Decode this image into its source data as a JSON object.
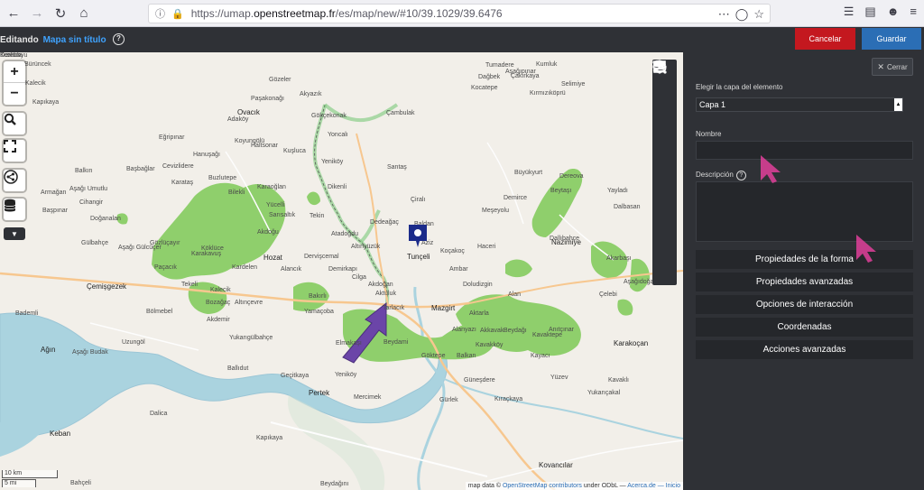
{
  "browser": {
    "url_prefix": "https://umap.",
    "url_domain": "openstreetmap.fr",
    "url_suffix": "/es/map/new/#10/39.1029/39.6476",
    "more_icon": "more-icon",
    "reader_icon": "pocket-icon",
    "star_icon": "bookmark-star-icon"
  },
  "header": {
    "editing_label": "Editando",
    "map_name": "Mapa sin título",
    "help_glyph": "?",
    "cancel_label": "Cancelar",
    "save_label": "Guardar"
  },
  "panel": {
    "close_label": "Cerrar",
    "layer_label": "Elegir la capa del elemento",
    "layer_value": "Capa 1",
    "name_label": "Nombre",
    "description_label": "Descripción",
    "help_glyph": "?",
    "sections": [
      "Propiedades de la forma",
      "Propiedades avanzadas",
      "Opciones de interacción",
      "Coordenadas",
      "Acciones avanzadas"
    ]
  },
  "map": {
    "marker_label": "Tunceli",
    "scale_km": "10 km",
    "scale_mi": "5 mi",
    "attribution_prefix": "map data © ",
    "attribution_link": "OpenStreetMap contributors",
    "attribution_suffix": " under ODbL — ",
    "attribution_about": "Acerca.de",
    "attribution_home": " — Inicio",
    "places": [
      {
        "name": "Bürüncek"
      },
      {
        "name": "Kalecik"
      },
      {
        "name": "Kapıkaya"
      },
      {
        "name": "Gözeler"
      },
      {
        "name": "Akyazık"
      },
      {
        "name": "Paşakonağı"
      },
      {
        "name": "Adaköy"
      },
      {
        "name": "Ovacık"
      },
      {
        "name": "Gökçekonak"
      },
      {
        "name": "Çambulak"
      },
      {
        "name": "Eğripınar"
      },
      {
        "name": "Yoncalı"
      },
      {
        "name": "Koyungölü"
      },
      {
        "name": "Kuşluca"
      },
      {
        "name": "Hanuşağı"
      },
      {
        "name": "Haltsonar"
      },
      {
        "name": "Yeniköy"
      },
      {
        "name": "Santaş"
      },
      {
        "name": "Balkın"
      },
      {
        "name": "Başbağlar"
      },
      {
        "name": "Cevizlidere"
      },
      {
        "name": "Buzlutepe"
      },
      {
        "name": "Karaoğlan"
      },
      {
        "name": "Dikenli"
      },
      {
        "name": "Aşağı Umutlu"
      },
      {
        "name": "Karataş"
      },
      {
        "name": "Bilekli"
      },
      {
        "name": "Armağan"
      },
      {
        "name": "Cihangir"
      },
      {
        "name": "Yücelli"
      },
      {
        "name": "Çiralı"
      },
      {
        "name": "Başpınar"
      },
      {
        "name": "Doğanalan"
      },
      {
        "name": "Sarısaltık"
      },
      {
        "name": "Tekin"
      },
      {
        "name": "Dedeağaç"
      },
      {
        "name": "Baldan"
      },
      {
        "name": "Gülbahçe"
      },
      {
        "name": "Aşağı Gülcüçer"
      },
      {
        "name": "Köklüce"
      },
      {
        "name": "Akdoğu"
      },
      {
        "name": "Atadoğdu"
      },
      {
        "name": "Koçakoç"
      },
      {
        "name": "Altınyüzük"
      },
      {
        "name": "Tunçeli"
      },
      {
        "name": "Aziz"
      },
      {
        "name": "Gözlüçayır"
      },
      {
        "name": "Karakavuş"
      },
      {
        "name": "Hozat"
      },
      {
        "name": "Dervişcemal"
      },
      {
        "name": "Demirkapı"
      },
      {
        "name": "Cilga"
      },
      {
        "name": "Paçacık"
      },
      {
        "name": "Kardelen"
      },
      {
        "name": "Alancık"
      },
      {
        "name": "Çemişgezek"
      },
      {
        "name": "Tekeli"
      },
      {
        "name": "Kalecik"
      },
      {
        "name": "Bakırlı"
      },
      {
        "name": "Aktuluk"
      },
      {
        "name": "Mazgirt"
      },
      {
        "name": "Ambar"
      },
      {
        "name": "Akdoğan"
      },
      {
        "name": "Bozağaç"
      },
      {
        "name": "Altınçevre"
      },
      {
        "name": "Yamaçoba"
      },
      {
        "name": "Tarlacık"
      },
      {
        "name": "Bademli"
      },
      {
        "name": "Bölmebel"
      },
      {
        "name": "Akdemir"
      },
      {
        "name": "Elmakaşı"
      },
      {
        "name": "Beydami"
      },
      {
        "name": "Yukarıgülbahçe"
      },
      {
        "name": "Göktepe"
      },
      {
        "name": "Balkan"
      },
      {
        "name": "Ağın"
      },
      {
        "name": "Aşağı Budak"
      },
      {
        "name": "Uzungöl"
      },
      {
        "name": "Pertek"
      },
      {
        "name": "Yeniköy"
      },
      {
        "name": "Mercimek"
      },
      {
        "name": "Güneşdere"
      },
      {
        "name": "Gürlek"
      },
      {
        "name": "Keban"
      },
      {
        "name": "Dalica"
      },
      {
        "name": "Kapıkaya"
      },
      {
        "name": "Kovancılar"
      },
      {
        "name": "Bahçeli"
      },
      {
        "name": "Beydağını"
      },
      {
        "name": "Kavakköy"
      },
      {
        "name": "Ballıdut"
      },
      {
        "name": "Geçitkaya"
      },
      {
        "name": "Kayacı"
      },
      {
        "name": "Yüzev"
      },
      {
        "name": "Yukarıçakal"
      },
      {
        "name": "Kavaklı"
      },
      {
        "name": "Karakoçan"
      },
      {
        "name": "Nazimiye"
      },
      {
        "name": "Demirce"
      },
      {
        "name": "Beytaşı"
      },
      {
        "name": "Büyükyurt"
      },
      {
        "name": "Dereova"
      },
      {
        "name": "Tumadere"
      },
      {
        "name": "Dağbek"
      },
      {
        "name": "Çakırkaya"
      },
      {
        "name": "Kırmızıköprü"
      },
      {
        "name": "Kocatepe"
      },
      {
        "name": "Yayladı"
      },
      {
        "name": "Dalbasan"
      },
      {
        "name": "Akarbaşı"
      },
      {
        "name": "Dallıbahçe"
      },
      {
        "name": "Haceri"
      },
      {
        "name": "Meşeyolu"
      },
      {
        "name": "Doludizgin"
      },
      {
        "name": "Alan"
      },
      {
        "name": "Aktarla"
      },
      {
        "name": "Alanyazı"
      },
      {
        "name": "Akkavak"
      },
      {
        "name": "Beydağı"
      },
      {
        "name": "Kavaktepe"
      },
      {
        "name": "Anıtçınar"
      },
      {
        "name": "Çelebi"
      },
      {
        "name": "Aşağıdoğan"
      },
      {
        "name": "Kıraçkaya"
      },
      {
        "name": "Aşağıpınar"
      },
      {
        "name": "Kumluk"
      },
      {
        "name": "Selimiye"
      },
      {
        "name": "Dereboyu"
      },
      {
        "name": "Kızılcık"
      },
      {
        "name": "Kozluca"
      }
    ]
  },
  "icons": {
    "zoom_in": "+",
    "zoom_out": "−"
  }
}
